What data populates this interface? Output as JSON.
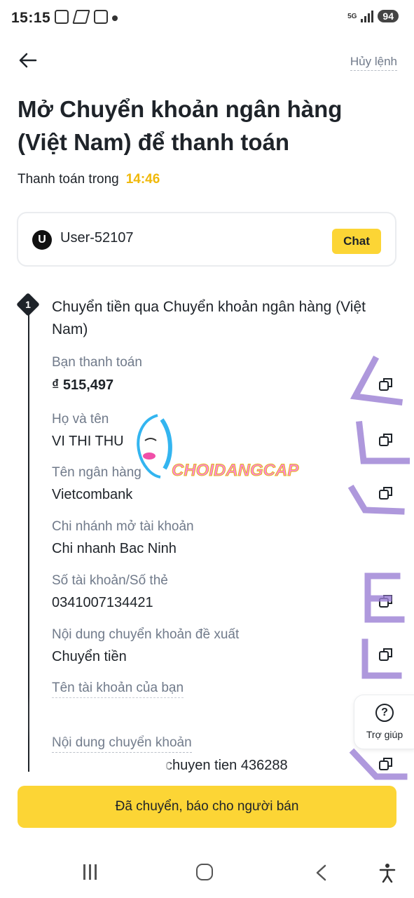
{
  "status_bar": {
    "time": "15:15",
    "network": "5G",
    "battery": "94"
  },
  "header": {
    "cancel_label": "Hủy lệnh",
    "title": "Mở Chuyển khoản ngân hàng (Việt Nam) để thanh toán",
    "pay_within_label": "Thanh toán trong",
    "countdown": "14:46"
  },
  "counterparty": {
    "avatar_letter": "U",
    "username": "User-52107",
    "chat_label": "Chat"
  },
  "step": {
    "number": "1",
    "title": "Chuyển tiền qua Chuyển khoản ngân hàng (Việt Nam)"
  },
  "fields": [
    {
      "label": "Bạn thanh toán",
      "value": "₫ 515,497"
    },
    {
      "label": "Họ và tên",
      "value": "VI THI THU"
    },
    {
      "label": "Tên ngân hàng",
      "value": "Vietcombank"
    },
    {
      "label": "Chi nhánh mở tài khoản",
      "value": "Chi nhanh Bac Ninh"
    },
    {
      "label": "Số tài khoản/Số thẻ",
      "value": "0341007134421"
    },
    {
      "label": "Nội dung chuyển khoản đề xuất",
      "value": "Chuyển tiền"
    },
    {
      "label": "Tên tài khoản của bạn",
      "value": ""
    },
    {
      "label": "Nội dung chuyển khoản",
      "value": "chuyen tien 436288"
    }
  ],
  "help": {
    "label": "Trợ giúp"
  },
  "primary_button": {
    "label": "Đã chuyển, báo cho người bán"
  },
  "watermark": {
    "text": "CHOIDANGCAP"
  },
  "colors": {
    "accent": "#fcd535",
    "timer": "#f0b90b",
    "muted": "#707a8a",
    "text": "#1e2329"
  }
}
